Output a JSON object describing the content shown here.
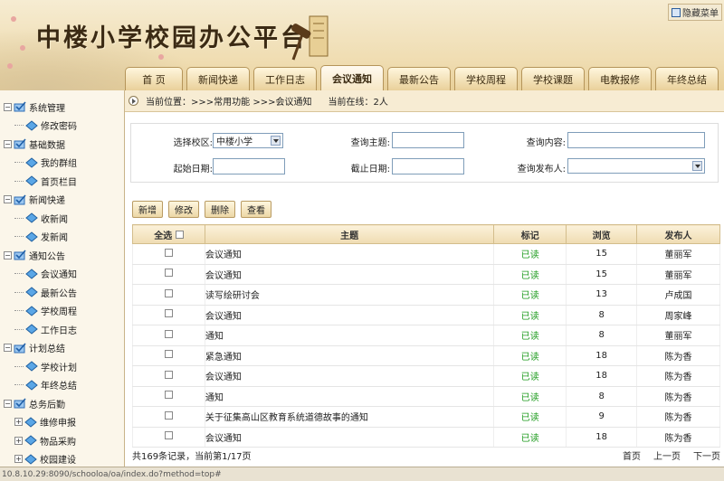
{
  "header": {
    "title": "中楼小学校园办公平台",
    "hide_menu": "隐藏菜单"
  },
  "tabs": [
    "首 页",
    "新闻快递",
    "工作日志",
    "会议通知",
    "最新公告",
    "学校周程",
    "学校课题",
    "电教报修",
    "年终总结"
  ],
  "active_tab": 3,
  "sidebar": [
    {
      "label": "系统管理",
      "level": 1,
      "toggle": "−"
    },
    {
      "label": "修改密码",
      "level": 2
    },
    {
      "label": "基础数据",
      "level": 1,
      "toggle": "−"
    },
    {
      "label": "我的群组",
      "level": 2
    },
    {
      "label": "首页栏目",
      "level": 2
    },
    {
      "label": "新闻快递",
      "level": 1,
      "toggle": "−"
    },
    {
      "label": "收新闻",
      "level": 2
    },
    {
      "label": "发新闻",
      "level": 2
    },
    {
      "label": "通知公告",
      "level": 1,
      "toggle": "−"
    },
    {
      "label": "会议通知",
      "level": 2
    },
    {
      "label": "最新公告",
      "level": 2
    },
    {
      "label": "学校周程",
      "level": 2
    },
    {
      "label": "工作日志",
      "level": 2
    },
    {
      "label": "计划总结",
      "level": 1,
      "toggle": "−"
    },
    {
      "label": "学校计划",
      "level": 2
    },
    {
      "label": "年终总结",
      "level": 2
    },
    {
      "label": "总务后勤",
      "level": 1,
      "toggle": "−"
    },
    {
      "label": "维修申报",
      "level": 2,
      "toggle": "+"
    },
    {
      "label": "物品采购",
      "level": 2,
      "toggle": "+"
    },
    {
      "label": "校园建设",
      "level": 2,
      "toggle": "+"
    }
  ],
  "breadcrumb": {
    "location": "当前位置：>>>常用功能 >>>会议通知",
    "online": "当前在线：2人"
  },
  "search": {
    "school_label": "选择校区:",
    "school_value": "中楼小学",
    "subject_label": "查询主题:",
    "content_label": "查询内容:",
    "start_label": "起始日期:",
    "end_label": "截止日期:",
    "publisher_label": "查询发布人:"
  },
  "toolbar": {
    "add": "新增",
    "edit": "修改",
    "delete": "删除",
    "view": "查看"
  },
  "table": {
    "headers": {
      "select_all": "全选",
      "subject": "主题",
      "mark": "标记",
      "views": "浏览",
      "publisher": "发布人"
    },
    "rows": [
      {
        "subject": "会议通知",
        "mark": "已读",
        "views": "15",
        "publisher": "董丽军"
      },
      {
        "subject": "会议通知",
        "mark": "已读",
        "views": "15",
        "publisher": "董丽军"
      },
      {
        "subject": "读写绘研讨会",
        "mark": "已读",
        "views": "13",
        "publisher": "卢成国"
      },
      {
        "subject": "会议通知",
        "mark": "已读",
        "views": "8",
        "publisher": "周家峰"
      },
      {
        "subject": "通知",
        "mark": "已读",
        "views": "8",
        "publisher": "董丽军"
      },
      {
        "subject": "紧急通知",
        "mark": "已读",
        "views": "18",
        "publisher": "陈为香"
      },
      {
        "subject": "会议通知",
        "mark": "已读",
        "views": "18",
        "publisher": "陈为香"
      },
      {
        "subject": "通知",
        "mark": "已读",
        "views": "8",
        "publisher": "陈为香"
      },
      {
        "subject": "关于征集高山区教育系统道德故事的通知",
        "mark": "已读",
        "views": "9",
        "publisher": "陈为香"
      },
      {
        "subject": "会议通知",
        "mark": "已读",
        "views": "18",
        "publisher": "陈为香"
      }
    ]
  },
  "footer": {
    "summary": "共169条记录，当前第1/17页",
    "first": "首页",
    "prev": "上一页",
    "next": "下一页"
  },
  "status_url": "10.8.10.29:8090/schooloa/oa/index.do?method=top#",
  "colors": {
    "read": "#1e9b1e",
    "accent": "#e9d09a"
  }
}
